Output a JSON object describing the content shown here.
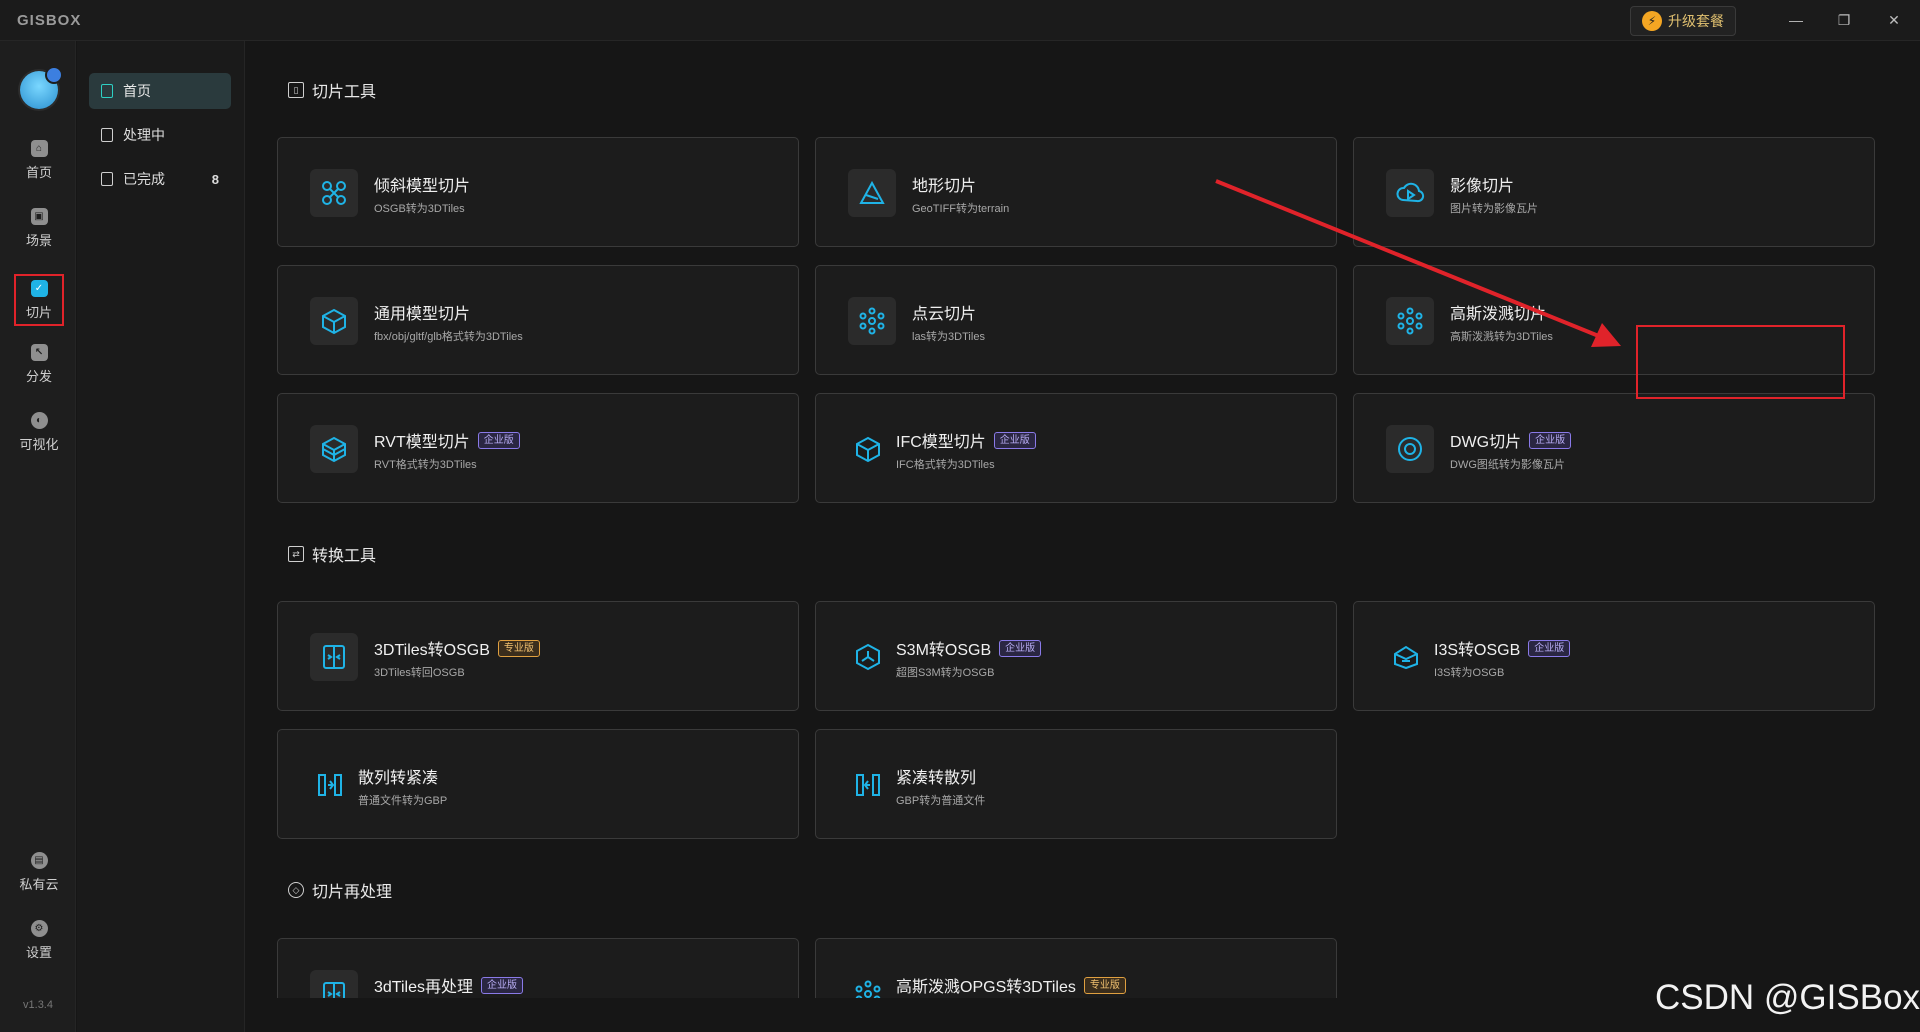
{
  "app": {
    "logo": "GISBOX",
    "upgrade_label": "升级套餐"
  },
  "window_controls": {
    "minimize": "—",
    "maximize": "❐",
    "close": "✕"
  },
  "rail": {
    "items": [
      {
        "label": "首页",
        "icon": "home-icon",
        "glyph": "⌂"
      },
      {
        "label": "场景",
        "icon": "cube-icon",
        "glyph": "▣"
      },
      {
        "label": "切片",
        "icon": "slice-icon",
        "glyph": "✓"
      },
      {
        "label": "分发",
        "icon": "distribute-icon",
        "glyph": "↖"
      },
      {
        "label": "可视化",
        "icon": "visual-icon",
        "glyph": "◐"
      }
    ],
    "bottom": [
      {
        "label": "私有云",
        "icon": "lock-icon",
        "glyph": "▤"
      },
      {
        "label": "设置",
        "icon": "settings-icon",
        "glyph": "⚙"
      }
    ],
    "version": "v1.3.4"
  },
  "subnav": {
    "items": [
      {
        "label": "首页"
      },
      {
        "label": "处理中"
      },
      {
        "label": "已完成",
        "count": "8"
      }
    ]
  },
  "sections": {
    "slice": {
      "title": "切片工具",
      "cards": [
        {
          "title": "倾斜模型切片",
          "sub": "OSGB转为3DTiles"
        },
        {
          "title": "地形切片",
          "sub": "GeoTIFF转为terrain"
        },
        {
          "title": "影像切片",
          "sub": "图片转为影像瓦片"
        },
        {
          "title": "通用模型切片",
          "sub": "fbx/obj/gltf/glb格式转为3DTiles"
        },
        {
          "title": "点云切片",
          "sub": "las转为3DTiles"
        },
        {
          "title": "高斯泼溅切片",
          "sub": "高斯泼溅转为3DTiles"
        },
        {
          "title": "RVT模型切片",
          "sub": "RVT格式转为3DTiles",
          "badge": "企业版"
        },
        {
          "title": "IFC模型切片",
          "sub": "IFC格式转为3DTiles",
          "badge": "企业版"
        },
        {
          "title": "DWG切片",
          "sub": "DWG图纸转为影像瓦片",
          "badge": "企业版"
        }
      ]
    },
    "convert": {
      "title": "转换工具",
      "cards": [
        {
          "title": "3DTiles转OSGB",
          "sub": "3DTiles转回OSGB",
          "badge": "专业版"
        },
        {
          "title": "S3M转OSGB",
          "sub": "超图S3M转为OSGB",
          "badge": "企业版"
        },
        {
          "title": "I3S转OSGB",
          "sub": "I3S转为OSGB",
          "badge": "企业版"
        },
        {
          "title": "散列转紧凑",
          "sub": "普通文件转为GBP"
        },
        {
          "title": "紧凑转散列",
          "sub": "GBP转为普通文件"
        }
      ]
    },
    "reprocess": {
      "title": "切片再处理",
      "cards": [
        {
          "title": "3dTiles再处理",
          "badge": "企业版"
        },
        {
          "title": "高斯泼溅OPGS转3DTiles",
          "badge": "专业版"
        }
      ]
    }
  },
  "watermark": "CSDN @GISBox",
  "colors": {
    "accent": "#2ed0c4",
    "icon": "#1fb3e6",
    "highlight": "#e0232a"
  }
}
